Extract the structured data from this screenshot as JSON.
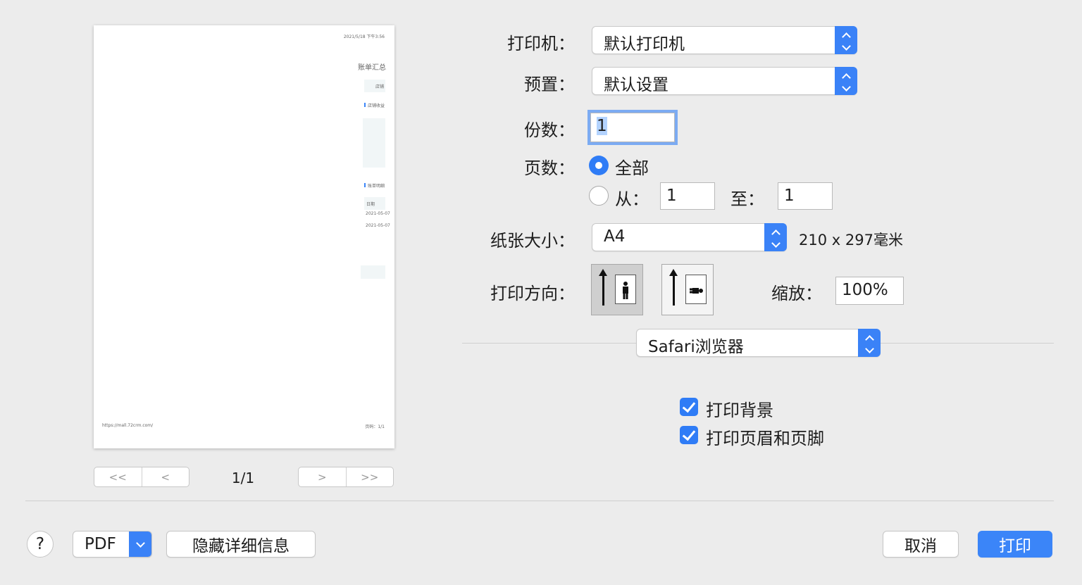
{
  "preview": {
    "timestamp": "2021/5/18 下午3:56",
    "title": "账单汇总",
    "store_label": "店铺",
    "section_income": "店铺收益",
    "section_bill": "账单明细",
    "col_date": "日期",
    "row1_date": "2021-05-07",
    "row2_date": "2021-05-07",
    "footer_url": "https://mall.72crm.com/",
    "footer_page": "页码：1/1",
    "page_indicator": "1/1",
    "nav_first": "<<",
    "nav_prev": "<",
    "nav_next": ">",
    "nav_last": ">>"
  },
  "form": {
    "printer_label": "打印机：",
    "printer_value": "默认打印机",
    "preset_label": "预置：",
    "preset_value": "默认设置",
    "copies_label": "份数：",
    "copies_value": "1",
    "pages_label": "页数：",
    "pages_all": "全部",
    "pages_from": "从：",
    "pages_from_value": "1",
    "pages_to": "至：",
    "pages_to_value": "1",
    "paper_label": "纸张大小：",
    "paper_value": "A4",
    "paper_dims": "210 x 297毫米",
    "orientation_label": "打印方向：",
    "scale_label": "缩放：",
    "scale_value": "100%",
    "section_popup": "Safari浏览器",
    "print_background": "打印背景",
    "print_header_footer": "打印页眉和页脚"
  },
  "footer": {
    "help": "?",
    "pdf": "PDF",
    "hide_details": "隐藏详细信息",
    "cancel": "取消",
    "print": "打印"
  },
  "colors": {
    "accent": "#3b85f8",
    "background": "#ececec"
  }
}
